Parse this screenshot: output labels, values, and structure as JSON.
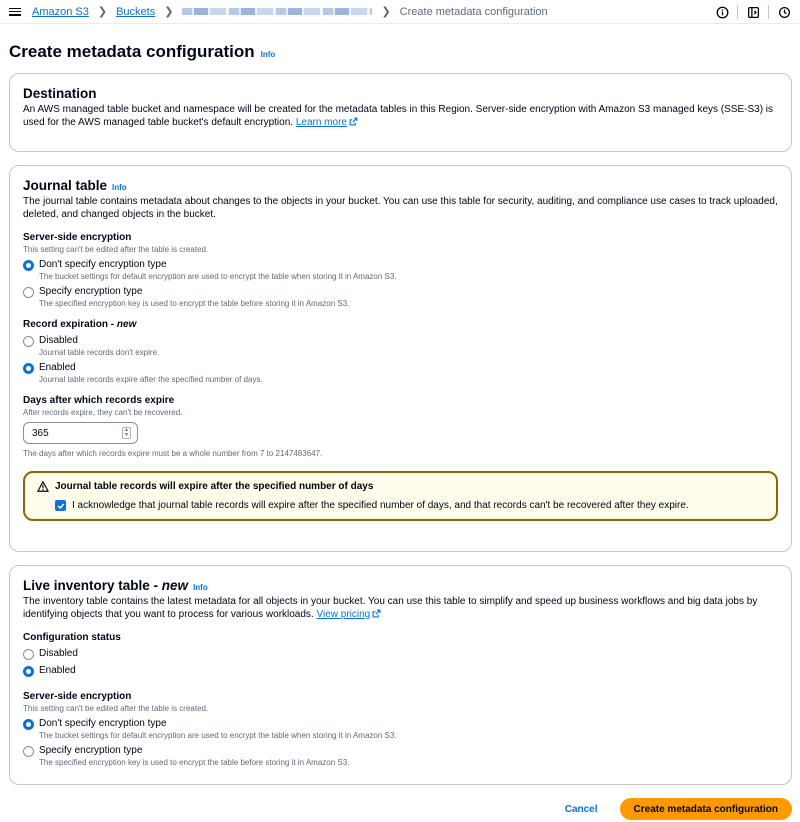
{
  "breadcrumb": {
    "items": [
      "Amazon S3",
      "Buckets"
    ],
    "current": "Create metadata configuration"
  },
  "page": {
    "title": "Create metadata configuration",
    "info": "Info"
  },
  "destination": {
    "title": "Destination",
    "description": "An AWS managed table bucket and namespace will be created for the metadata tables in this Region. Server-side encryption with Amazon S3 managed keys (SSE-S3) is used for the AWS managed table bucket's default encryption.",
    "learn_more": "Learn more"
  },
  "journal": {
    "title": "Journal table",
    "info": "Info",
    "description": "The journal table contains metadata about changes to the objects in your bucket. You can use this table for security, auditing, and compliance use cases to track uploaded, deleted, and changed objects in the bucket.",
    "sse": {
      "label": "Server-side encryption",
      "desc": "This setting can't be edited after the table is created.",
      "options": [
        {
          "label": "Don't specify encryption type",
          "desc": "The bucket settings for default encryption are used to encrypt the table when storing it in Amazon S3.",
          "checked": true
        },
        {
          "label": "Specify encryption type",
          "desc": "The specified encryption key is used to encrypt the table before storing it in Amazon S3.",
          "checked": false
        }
      ]
    },
    "expiration": {
      "label": "Record expiration - ",
      "label_new": "new",
      "options": [
        {
          "label": "Disabled",
          "desc": "Journal table records don't expire.",
          "checked": false
        },
        {
          "label": "Enabled",
          "desc": "Journal table records expire after the specified number of days.",
          "checked": true
        }
      ]
    },
    "days": {
      "label": "Days after which records expire",
      "desc": "After records expire, they can't be recovered.",
      "value": "365",
      "constraint": "The days after which records expire must be a whole number from 7 to 2147483647."
    },
    "alert": {
      "title": "Journal table records will expire after the specified number of days",
      "ack": "I acknowledge that journal table records will expire after the specified number of days, and that records can't be recovered after they expire."
    }
  },
  "inventory": {
    "title": "Live inventory table - ",
    "title_new": "new",
    "info": "Info",
    "description": "The inventory table contains the latest metadata for all objects in your bucket. You can use this table to simplify and speed up business workflows and big data jobs by identifying objects that you want to process for various workloads.",
    "pricing": "View pricing",
    "config": {
      "label": "Configuration status",
      "options": [
        {
          "label": "Disabled",
          "checked": false
        },
        {
          "label": "Enabled",
          "checked": true
        }
      ]
    },
    "sse": {
      "label": "Server-side encryption",
      "desc": "This setting can't be edited after the table is created.",
      "options": [
        {
          "label": "Don't specify encryption type",
          "desc": "The bucket settings for default encryption are used to encrypt the table when storing it in Amazon S3.",
          "checked": true
        },
        {
          "label": "Specify encryption type",
          "desc": "The specified encryption key is used to encrypt the table before storing it in Amazon S3.",
          "checked": false
        }
      ]
    }
  },
  "footer": {
    "cancel": "Cancel",
    "submit": "Create metadata configuration"
  },
  "colors": {
    "link": "#0972d3",
    "primary": "#ff9900",
    "warning_border": "#8d6605",
    "warning_bg": "#fffce9"
  },
  "icons": [
    "menu-icon",
    "chevron-right-icon",
    "info-circle-icon",
    "exit-panel-icon",
    "history-icon",
    "external-link-icon",
    "warning-icon",
    "check-icon"
  ]
}
